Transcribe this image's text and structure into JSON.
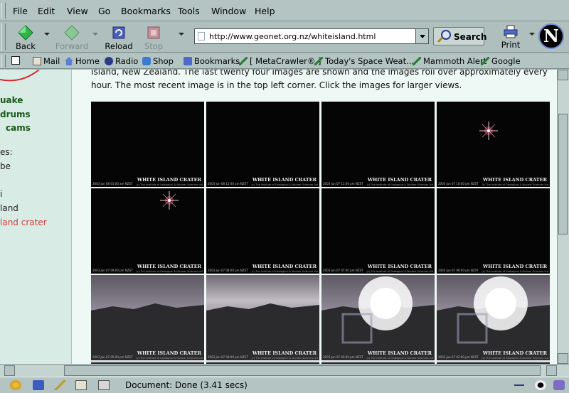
{
  "menubar": {
    "items": [
      "File",
      "Edit",
      "View",
      "Go",
      "Bookmarks",
      "Tools",
      "Window",
      "Help"
    ]
  },
  "navbar": {
    "back": "Back",
    "forward": "Forward",
    "reload": "Reload",
    "stop": "Stop",
    "url": "http://www.geonet.org.nz/whiteisland.html",
    "search": "Search",
    "print": "Print",
    "logo": "N"
  },
  "personalbar": {
    "items": [
      "Mail",
      "Home",
      "Radio",
      "Shop",
      "Bookmarks",
      "[ MetaCrawler® ]",
      "Today's Space Weat...",
      "Mammoth Alert",
      "Google"
    ]
  },
  "sidebar": {
    "items": [
      "uake",
      "drums",
      "cams",
      "es:",
      "be",
      "i",
      "land",
      "land crater"
    ]
  },
  "content": {
    "intro": "Island, New Zealand. The last twenty four images are shown and the images roll over approximately every hour. The most recent image is in the top left corner. Click the images for larger views.",
    "cams": [
      {
        "caption": "WHITE ISLAND CRATER",
        "date": "2003 Jun 08 01:00 am NZST"
      },
      {
        "caption": "WHITE ISLAND CRATER",
        "date": "2003 Jun 08 12:00 am NZST"
      },
      {
        "caption": "WHITE ISLAND CRATER",
        "date": "2003 Jun 07 11:00 pm NZST"
      },
      {
        "caption": "WHITE ISLAND CRATER",
        "date": "2003 Jun 07 10:00 pm NZST"
      },
      {
        "caption": "WHITE ISLAND CRATER",
        "date": "2003 Jun 07 09:00 pm NZST"
      },
      {
        "caption": "WHITE ISLAND CRATER",
        "date": "2003 Jun 07 08:00 pm NZST"
      },
      {
        "caption": "WHITE ISLAND CRATER",
        "date": "2003 Jun 07 07:00 pm NZST"
      },
      {
        "caption": "WHITE ISLAND CRATER",
        "date": "2003 Jun 07 06:00 pm NZST"
      },
      {
        "caption": "WHITE ISLAND CRATER",
        "date": "2003 Jun 07 05:00 pm NZST"
      },
      {
        "caption": "WHITE ISLAND CRATER",
        "date": "2003 Jun 07 04:00 pm NZST"
      },
      {
        "caption": "WHITE ISLAND CRATER",
        "date": "2003 Jun 07 03:00 pm NZST"
      },
      {
        "caption": "WHITE ISLAND CRATER",
        "date": "2003 Jun 07 02:00 pm NZST"
      }
    ],
    "credit": "(c) The Institute of Geological & Nuclear Sciences Ltd"
  },
  "status": {
    "text": "Document: Done (3.41 secs)"
  }
}
